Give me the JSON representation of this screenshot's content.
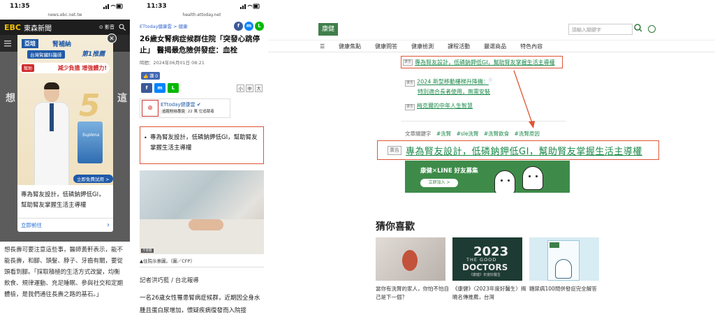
{
  "colors": {
    "highlight": "#e05535",
    "kj_green": "#3f7f4a",
    "link_green": "#1b8a4a",
    "ad_blue": "#1f5aa8"
  },
  "panel1": {
    "status_time": "11:35",
    "url": "news.ebc.net.tw",
    "site_logo": "EBC",
    "site_name": "東森新聞",
    "video_label": "影音",
    "bg_title_left": "想",
    "bg_title_right": "這",
    "ad": {
      "brand_box": "亞培",
      "brand_name": "腎補納",
      "award_tag": "台灣腎臟科醫師",
      "award_rank": "第1推薦",
      "slogan_tag": "幫助",
      "slogan": "減少負擔 增強體力!",
      "big_number": "5",
      "can_label": "Suplena",
      "cta": "立即免費試用 >",
      "text": "專為腎友設計，低磷鈉鉀低GI，幫助腎友掌握生活主導權",
      "footer_link": "立即前往",
      "footer_chevron": "›"
    },
    "body_text": "想長壽可要注意這些事，醫師黃軒表示，能不能長壽，和腳、頭髮、脖子、牙齒有關，要從頭看到腳。「採取積極的生活方式改變，均衡飲食、規律運動、充足睡眠、參與社交和定期體檢，是我們通往長壽之路的基石。」"
  },
  "panel2": {
    "status_time": "11:33",
    "url": "health.ettoday.net",
    "breadcrumb": "ETtoday健康雲 > 健康",
    "title": "26歲女腎病症候群住院「突發心跳停止」 醫揭最危險併發症：血栓",
    "date": "時間：2024年06月01日 08:21",
    "like_label": "👍 讚 0",
    "font_sizes": [
      "小",
      "中",
      "大"
    ],
    "author_card": {
      "name": "ETtoday健康雲 ✔",
      "sub": "追蹤粉絲專頁",
      "followers": "22 萬 位追蹤者"
    },
    "highlight_text": "專為腎友設計，低磷鈉鉀低GI，幫助腎友掌握生活主導權",
    "photo_tag": "示意圖",
    "caption": "▲住院示意圖。（圖／CFP）",
    "reporter": "記者洪巧藍 / 台北報導",
    "body": "一名26歲女性罹患腎病症候群，近期因全身水腫且蛋白尿增加，懷疑疾病復發而入院接"
  },
  "panel3": {
    "logo": "康健",
    "search_placeholder": "請輸入關鍵字",
    "nav": [
      "☰",
      "健康焦點",
      "健康問答",
      "健康檢測",
      "課程活動",
      "嚴選商品",
      "特色內容"
    ],
    "ad_tag": "廣告",
    "top_ad_link": "專為腎友設計，低磷鈉鉀低GI，幫助腎友掌握生活主導權",
    "rel2_link_line1": "2024 新型移動樓梯升降機：",
    "rel2_link_line2": "特別適合長者使用，無需安裝",
    "rel2_sup": "ⓘ",
    "rel3_link": "梅克爾的中年人生智慧",
    "keywords_label": "文章關鍵字",
    "keywords": [
      "#洗腎",
      "#sle洗腎",
      "#洗腎飲食",
      "#洗腎原因"
    ],
    "big_ad_link": "專為腎友設計，低磷鈉鉀低GI，幫助腎友掌握生活主導權",
    "line_banner": {
      "title": "康健✕LINE 好友募集",
      "button": "立即加入 >"
    },
    "guess_title": "猜你喜歡",
    "cards": [
      {
        "caption": "當你有洗腎的家人，你怕不怕自己是下一個？"
      },
      {
        "year": "2023",
        "line1": "THE GOOD",
        "line2": "DOCTORS",
        "sub": "《康健》年度好醫生",
        "caption": "《康健》〈2023年度好醫生〉揭曉名傳推薦，台灣"
      },
      {
        "caption": "糖尿病100問併發症完全解答"
      }
    ]
  }
}
